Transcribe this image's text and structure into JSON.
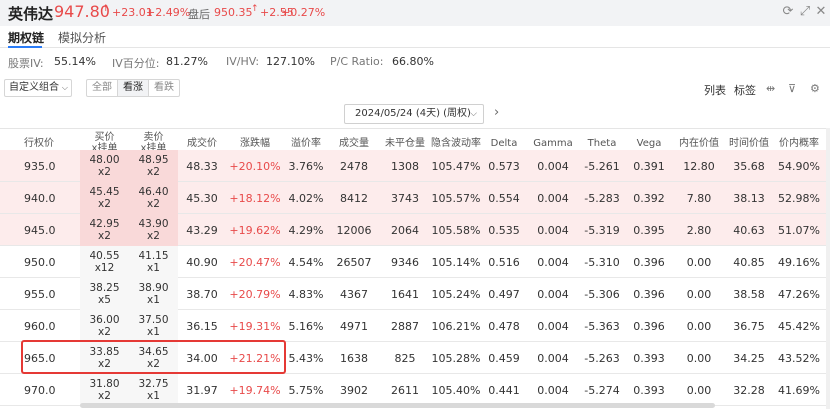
{
  "header": {
    "stock_name": "英伟达",
    "price": "947.80",
    "price_arrow": "↑",
    "change": "+23.01",
    "change_pct": "+2.49%",
    "after_hours_label": "盘后",
    "after_hours_price": "950.35",
    "after_hours_arrow": "↑",
    "after_hours_change": "+2.55",
    "after_hours_change_pct": "+0.27%",
    "icons": [
      "refresh-icon",
      "expand-icon",
      "close-icon"
    ]
  },
  "tabs": [
    {
      "label": "期权链",
      "active": true
    },
    {
      "label": "模拟分析",
      "active": false
    }
  ],
  "stats": {
    "iv_label": "股票IV:",
    "iv_value": "55.14%",
    "ivp_label": "IV百分位:",
    "ivp_value": "81.27%",
    "ivhv_label": "IV/HV:",
    "ivhv_value": "127.10%",
    "pc_label": "P/C Ratio:",
    "pc_value": "66.80%"
  },
  "toolbar": {
    "combo_label": "自定义组合",
    "seg_all": "全部",
    "seg_up": "看涨",
    "seg_down": "看跌",
    "list_label": "列表",
    "tag_label": "标签"
  },
  "date_selector": {
    "value": "2024/05/24 (4天) (周权)"
  },
  "columns": {
    "strike": "行权价",
    "bid": [
      "买价",
      "x挂单"
    ],
    "ask": [
      "卖价",
      "x挂单"
    ],
    "last": "成交价",
    "change_pct": "涨跌幅",
    "premium": "溢价率",
    "volume": "成交量",
    "open_interest": "未平仓量",
    "iv": "隐含波动率",
    "delta": "Delta",
    "gamma": "Gamma",
    "theta": "Theta",
    "vega": "Vega",
    "intrinsic": "内在价值",
    "time_value": "时间价值",
    "itm_prob": "价内概率"
  },
  "rows": [
    {
      "strike": "935.0",
      "bid": "48.00",
      "bid_size": "x2",
      "ask": "48.95",
      "ask_size": "x2",
      "last": "48.33",
      "change_pct": "+20.10%",
      "premium": "3.76%",
      "volume": "2478",
      "open_interest": "1308",
      "iv": "105.47%",
      "delta": "0.573",
      "gamma": "0.004",
      "theta": "-5.261",
      "vega": "0.391",
      "intrinsic": "12.80",
      "time_value": "35.68",
      "itm_prob": "54.90%",
      "in_the_money": true
    },
    {
      "strike": "940.0",
      "bid": "45.45",
      "bid_size": "x2",
      "ask": "46.40",
      "ask_size": "x2",
      "last": "45.30",
      "change_pct": "+18.12%",
      "premium": "4.02%",
      "volume": "8412",
      "open_interest": "3743",
      "iv": "105.57%",
      "delta": "0.554",
      "gamma": "0.004",
      "theta": "-5.283",
      "vega": "0.392",
      "intrinsic": "7.80",
      "time_value": "38.13",
      "itm_prob": "52.98%",
      "in_the_money": true
    },
    {
      "strike": "945.0",
      "bid": "42.95",
      "bid_size": "x2",
      "ask": "43.90",
      "ask_size": "x2",
      "last": "43.29",
      "change_pct": "+19.62%",
      "premium": "4.29%",
      "volume": "12006",
      "open_interest": "2064",
      "iv": "105.58%",
      "delta": "0.535",
      "gamma": "0.004",
      "theta": "-5.319",
      "vega": "0.395",
      "intrinsic": "2.80",
      "time_value": "40.63",
      "itm_prob": "51.07%",
      "in_the_money": true
    },
    {
      "strike": "950.0",
      "bid": "40.55",
      "bid_size": "x12",
      "ask": "41.15",
      "ask_size": "x1",
      "last": "40.90",
      "change_pct": "+20.47%",
      "premium": "4.54%",
      "volume": "26507",
      "open_interest": "9346",
      "iv": "105.14%",
      "delta": "0.516",
      "gamma": "0.004",
      "theta": "-5.310",
      "vega": "0.396",
      "intrinsic": "0.00",
      "time_value": "40.85",
      "itm_prob": "49.16%",
      "in_the_money": false
    },
    {
      "strike": "955.0",
      "bid": "38.25",
      "bid_size": "x5",
      "ask": "38.90",
      "ask_size": "x1",
      "last": "38.70",
      "change_pct": "+20.79%",
      "premium": "4.83%",
      "volume": "4367",
      "open_interest": "1641",
      "iv": "105.24%",
      "delta": "0.497",
      "gamma": "0.004",
      "theta": "-5.306",
      "vega": "0.396",
      "intrinsic": "0.00",
      "time_value": "38.58",
      "itm_prob": "47.26%",
      "in_the_money": false
    },
    {
      "strike": "960.0",
      "bid": "36.00",
      "bid_size": "x2",
      "ask": "37.50",
      "ask_size": "x1",
      "last": "36.15",
      "change_pct": "+19.31%",
      "premium": "5.16%",
      "volume": "4971",
      "open_interest": "2887",
      "iv": "106.21%",
      "delta": "0.478",
      "gamma": "0.004",
      "theta": "-5.363",
      "vega": "0.396",
      "intrinsic": "0.00",
      "time_value": "36.75",
      "itm_prob": "45.42%",
      "in_the_money": false
    },
    {
      "strike": "965.0",
      "bid": "33.85",
      "bid_size": "x2",
      "ask": "34.65",
      "ask_size": "x2",
      "last": "34.00",
      "change_pct": "+21.21%",
      "premium": "5.43%",
      "volume": "1638",
      "open_interest": "825",
      "iv": "105.28%",
      "delta": "0.459",
      "gamma": "0.004",
      "theta": "-5.263",
      "vega": "0.393",
      "intrinsic": "0.00",
      "time_value": "34.25",
      "itm_prob": "43.52%",
      "in_the_money": false
    },
    {
      "strike": "970.0",
      "bid": "31.80",
      "bid_size": "x2",
      "ask": "32.75",
      "ask_size": "x1",
      "last": "31.97",
      "change_pct": "+19.74%",
      "premium": "5.75%",
      "volume": "3902",
      "open_interest": "2611",
      "iv": "105.40%",
      "delta": "0.441",
      "gamma": "0.004",
      "theta": "-5.274",
      "vega": "0.393",
      "intrinsic": "0.00",
      "time_value": "32.28",
      "itm_prob": "41.69%",
      "in_the_money": false
    }
  ],
  "colors": {
    "up": "#e84a4a",
    "accent": "#2a7cf7",
    "itm_row": "#fdecec",
    "highlight_border": "#e53935"
  }
}
